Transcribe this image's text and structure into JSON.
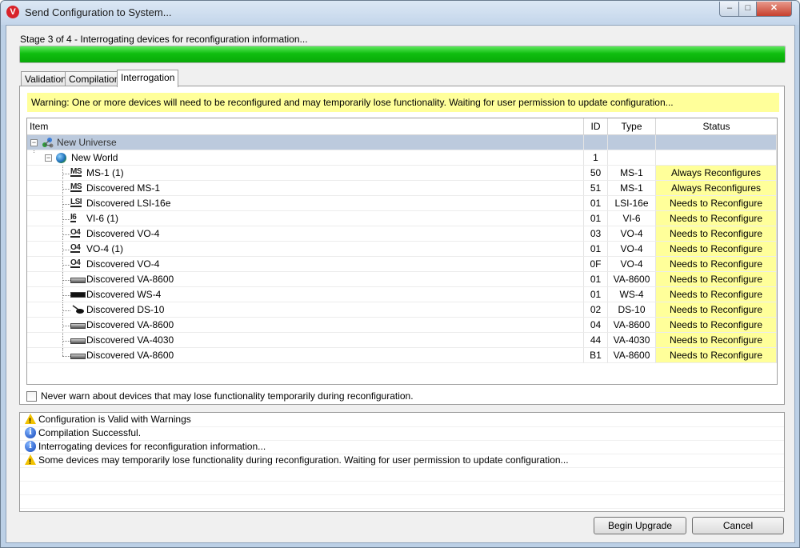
{
  "window": {
    "title": "Send Configuration to System...",
    "icon": "app-logo-icon",
    "controls": {
      "minimize": "–",
      "maximize": "□",
      "close": "✕"
    }
  },
  "stage": {
    "text": "Stage 3 of 4 - Interrogating devices for reconfiguration information...",
    "progress_fraction": 1.0,
    "progress_color": "#0fbe0f"
  },
  "tabs": [
    {
      "label": "Validation",
      "active": false
    },
    {
      "label": "Compilation",
      "active": false
    },
    {
      "label": "Interrogation",
      "active": true
    }
  ],
  "warning": {
    "text": "Warning: One or more devices will need to be reconfigured and may temporarily lose functionality. Waiting for user permission to update configuration...",
    "color": "#ffff9a"
  },
  "grid": {
    "columns": [
      "Item",
      "ID",
      "Type",
      "Status"
    ],
    "rows": [
      {
        "item": "New Universe",
        "id": "",
        "type": "",
        "status": "",
        "icon": "universe-icon",
        "level": 0,
        "selected": true
      },
      {
        "item": "New World",
        "id": "1",
        "type": "",
        "status": "",
        "icon": "globe-icon",
        "level": 1
      },
      {
        "item": "MS-1 (1)",
        "id": "50",
        "type": "MS-1",
        "status": "Always Reconfigures",
        "icon": "ms-device-icon",
        "glyph": "MS",
        "level": 2
      },
      {
        "item": "Discovered MS-1",
        "id": "51",
        "type": "MS-1",
        "status": "Always Reconfigures",
        "icon": "ms-device-icon",
        "glyph": "MS",
        "level": 2
      },
      {
        "item": "Discovered LSI-16e",
        "id": "01",
        "type": "LSI-16e",
        "status": "Needs to Reconfigure",
        "icon": "lsi-device-icon",
        "glyph": "LSI",
        "level": 2
      },
      {
        "item": "VI-6 (1)",
        "id": "01",
        "type": "VI-6",
        "status": "Needs to Reconfigure",
        "icon": "vi-device-icon",
        "glyph": "I6",
        "level": 2
      },
      {
        "item": "Discovered VO-4",
        "id": "03",
        "type": "VO-4",
        "status": "Needs to Reconfigure",
        "icon": "vo-device-icon",
        "glyph": "O4",
        "level": 2
      },
      {
        "item": "VO-4 (1)",
        "id": "01",
        "type": "VO-4",
        "status": "Needs to Reconfigure",
        "icon": "vo-device-icon",
        "glyph": "O4",
        "level": 2
      },
      {
        "item": "Discovered VO-4",
        "id": "0F",
        "type": "VO-4",
        "status": "Needs to Reconfigure",
        "icon": "vo-device-icon",
        "glyph": "O4",
        "level": 2
      },
      {
        "item": "Discovered VA-8600",
        "id": "01",
        "type": "VA-8600",
        "status": "Needs to Reconfigure",
        "icon": "amplifier-icon",
        "level": 2
      },
      {
        "item": "Discovered WS-4",
        "id": "01",
        "type": "WS-4",
        "status": "Needs to Reconfigure",
        "icon": "wall-station-icon",
        "level": 2
      },
      {
        "item": "Discovered DS-10",
        "id": "02",
        "type": "DS-10",
        "status": "Needs to Reconfigure",
        "icon": "ds-device-icon",
        "level": 2
      },
      {
        "item": "Discovered VA-8600",
        "id": "04",
        "type": "VA-8600",
        "status": "Needs to Reconfigure",
        "icon": "amplifier-icon",
        "level": 2
      },
      {
        "item": "Discovered VA-4030",
        "id": "44",
        "type": "VA-4030",
        "status": "Needs to Reconfigure",
        "icon": "amplifier-icon",
        "level": 2
      },
      {
        "item": "Discovered VA-8600",
        "id": "B1",
        "type": "VA-8600",
        "status": "Needs to Reconfigure",
        "icon": "amplifier-icon",
        "level": 2
      }
    ],
    "status_color": "#ffff9a",
    "selected_color": "#bccadd"
  },
  "never_warn": {
    "label": "Never warn about devices that may lose functionality temporarily during reconfiguration.",
    "checked": false
  },
  "log": [
    {
      "type": "warning",
      "icon": "warning-icon",
      "text": "Configuration is Valid with Warnings"
    },
    {
      "type": "info",
      "icon": "info-icon",
      "text": "Compilation Successful."
    },
    {
      "type": "info",
      "icon": "info-icon",
      "text": "Interrogating devices for reconfiguration information..."
    },
    {
      "type": "warning",
      "icon": "warning-icon",
      "text": "Some devices may temporarily lose functionality during reconfiguration. Waiting for user permission to update configuration..."
    }
  ],
  "buttons": {
    "begin_upgrade": "Begin Upgrade",
    "cancel": "Cancel"
  }
}
